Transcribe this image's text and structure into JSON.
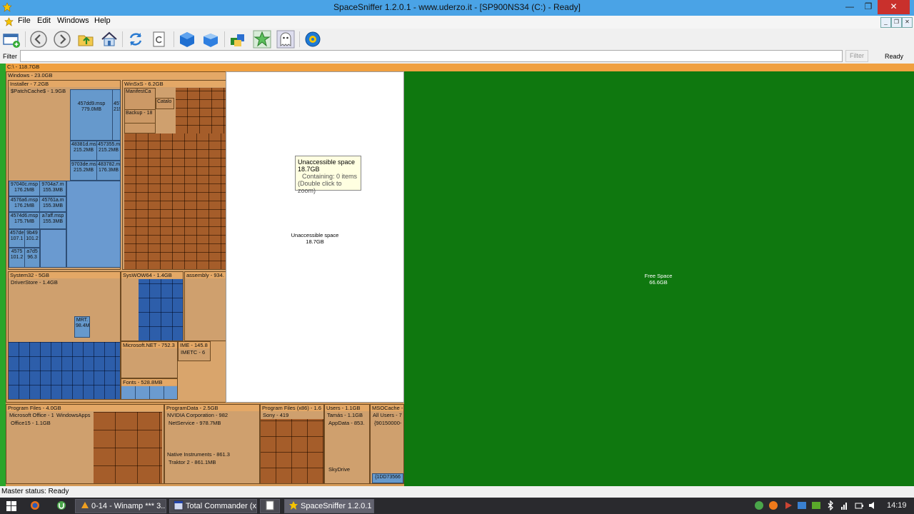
{
  "window": {
    "title": "SpaceSniffer 1.2.0.1 - www.uderzo.it - [SP900NS34 (C:) - Ready]",
    "minimize": "—",
    "maximize": "❐",
    "close": "✕"
  },
  "menu": {
    "items": [
      "File",
      "Edit",
      "Windows",
      "Help"
    ]
  },
  "filter": {
    "label": "Filter",
    "value": "",
    "button": "Filter",
    "status": "Ready"
  },
  "treemap": {
    "root": "C:\\ - 118.7GB",
    "windows": "Windows - 23.0GB",
    "installer": "Installer - 7.2GB",
    "patchcache": "$PatchCache$ - 1.9GB",
    "winsxs": "WinSxS - 6.2GB",
    "winsxs_manifest": "ManifestCa",
    "winsxs_catalog": "Catalo",
    "winsxs_backup": "Backup - 18",
    "system32": "System32 - 5GB",
    "driverstore": "DriverStore - 1.4GB",
    "syswow64": "SysWOW64 - 1.4GB",
    "assembly": "assembly - 934.",
    "microsoftnet": "Microsoft.NET - 752.3",
    "ime": "IME - 145.8",
    "imetc": "IMETC - 6",
    "fonts": "Fonts - 528.8MB",
    "programfiles": "Program Files - 4.0GB",
    "msoffice": "Microsoft Office - 1",
    "office15": "Office15 - 1.1GB",
    "windowsapps": "WindowsApps",
    "programdata": "ProgramData - 2.5GB",
    "nvidia": "NVIDIA Corporation - 982",
    "netservice": "NetService - 978.7MB",
    "nativeinst": "Native Instruments - 861.3",
    "traktor": "Traktor 2 - 861.1MB",
    "pfx86": "Program Files (x86) - 1.6",
    "sony": "Sony - 419",
    "users": "Users - 1.1GB",
    "tamas": "Tamás - 1.1GB",
    "appdata": "AppData - 853.",
    "skydrive": "SkyDrive",
    "msocache": "MSOCache -",
    "allusers": "All Users - 7",
    "msocache_guid": "{90150000-",
    "msocache_guid2": "{1DD73566",
    "files": [
      "457dd9.msp\n779.0MB",
      "457\n215",
      "48381d.ms\n215.2MB",
      "457355.m\n215.2MB",
      "9703de.ms\n215.2MB",
      "483782.m\n176.3MB",
      "97040c.msp\n176.2MB",
      "9704a7.m\n155.3MB",
      "4576a6.msp\n176.2MB",
      "45761a.m\n155.3MB",
      "4574d6.msp\n175.7MB",
      "a7aff.msp\n155.3MB",
      "457de\n107.1",
      "9b49\n101.2",
      "4575\n101.2",
      "a7d5\n96.3",
      "MRT.\n98.4M"
    ],
    "unaccessible": {
      "name": "Unaccessible space",
      "size": "18.7GB"
    },
    "freespace": {
      "name": "Free Space",
      "size": "66.6GB"
    }
  },
  "tooltip": {
    "title": "Unaccessible space",
    "size": "18.7GB",
    "containing": "Containing: 0 items",
    "hint": "(Double click to zoom)"
  },
  "status": {
    "text": "Master status: Ready"
  },
  "taskbar": {
    "tasks": [
      "0-14 - Winamp *** 3...",
      "Total Commander (x...",
      "",
      "SpaceSniffer 1.2.0.1 -..."
    ],
    "clock": "14:19"
  }
}
